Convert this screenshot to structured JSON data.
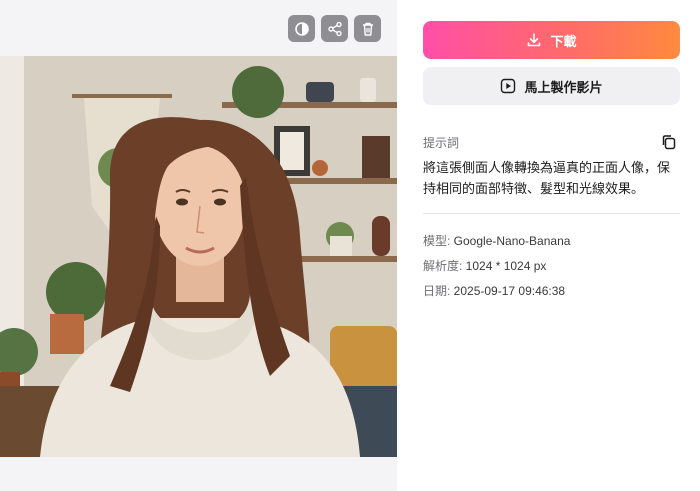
{
  "toolbar": {
    "compare_icon": "compare-icon",
    "share_icon": "share-icon",
    "delete_icon": "trash-icon"
  },
  "actions": {
    "download_label": "下載",
    "make_video_label": "馬上製作影片"
  },
  "prompt": {
    "label": "提示詞",
    "text": "將這張側面人像轉換為逼真的正面人像，保持相同的面部特徵、髮型和光線效果。"
  },
  "meta": {
    "model_label": "模型: ",
    "model_value": "Google-Nano-Banana",
    "resolution_label": "解析度: ",
    "resolution_value": "1024 * 1024 px",
    "date_label": "日期: ",
    "date_value": "2025-09-17 09:46:38"
  },
  "colors": {
    "download_gradient_start": "#ff4fa8",
    "download_gradient_end": "#ff8a3d",
    "tool_button_bg": "#8e8e93"
  }
}
